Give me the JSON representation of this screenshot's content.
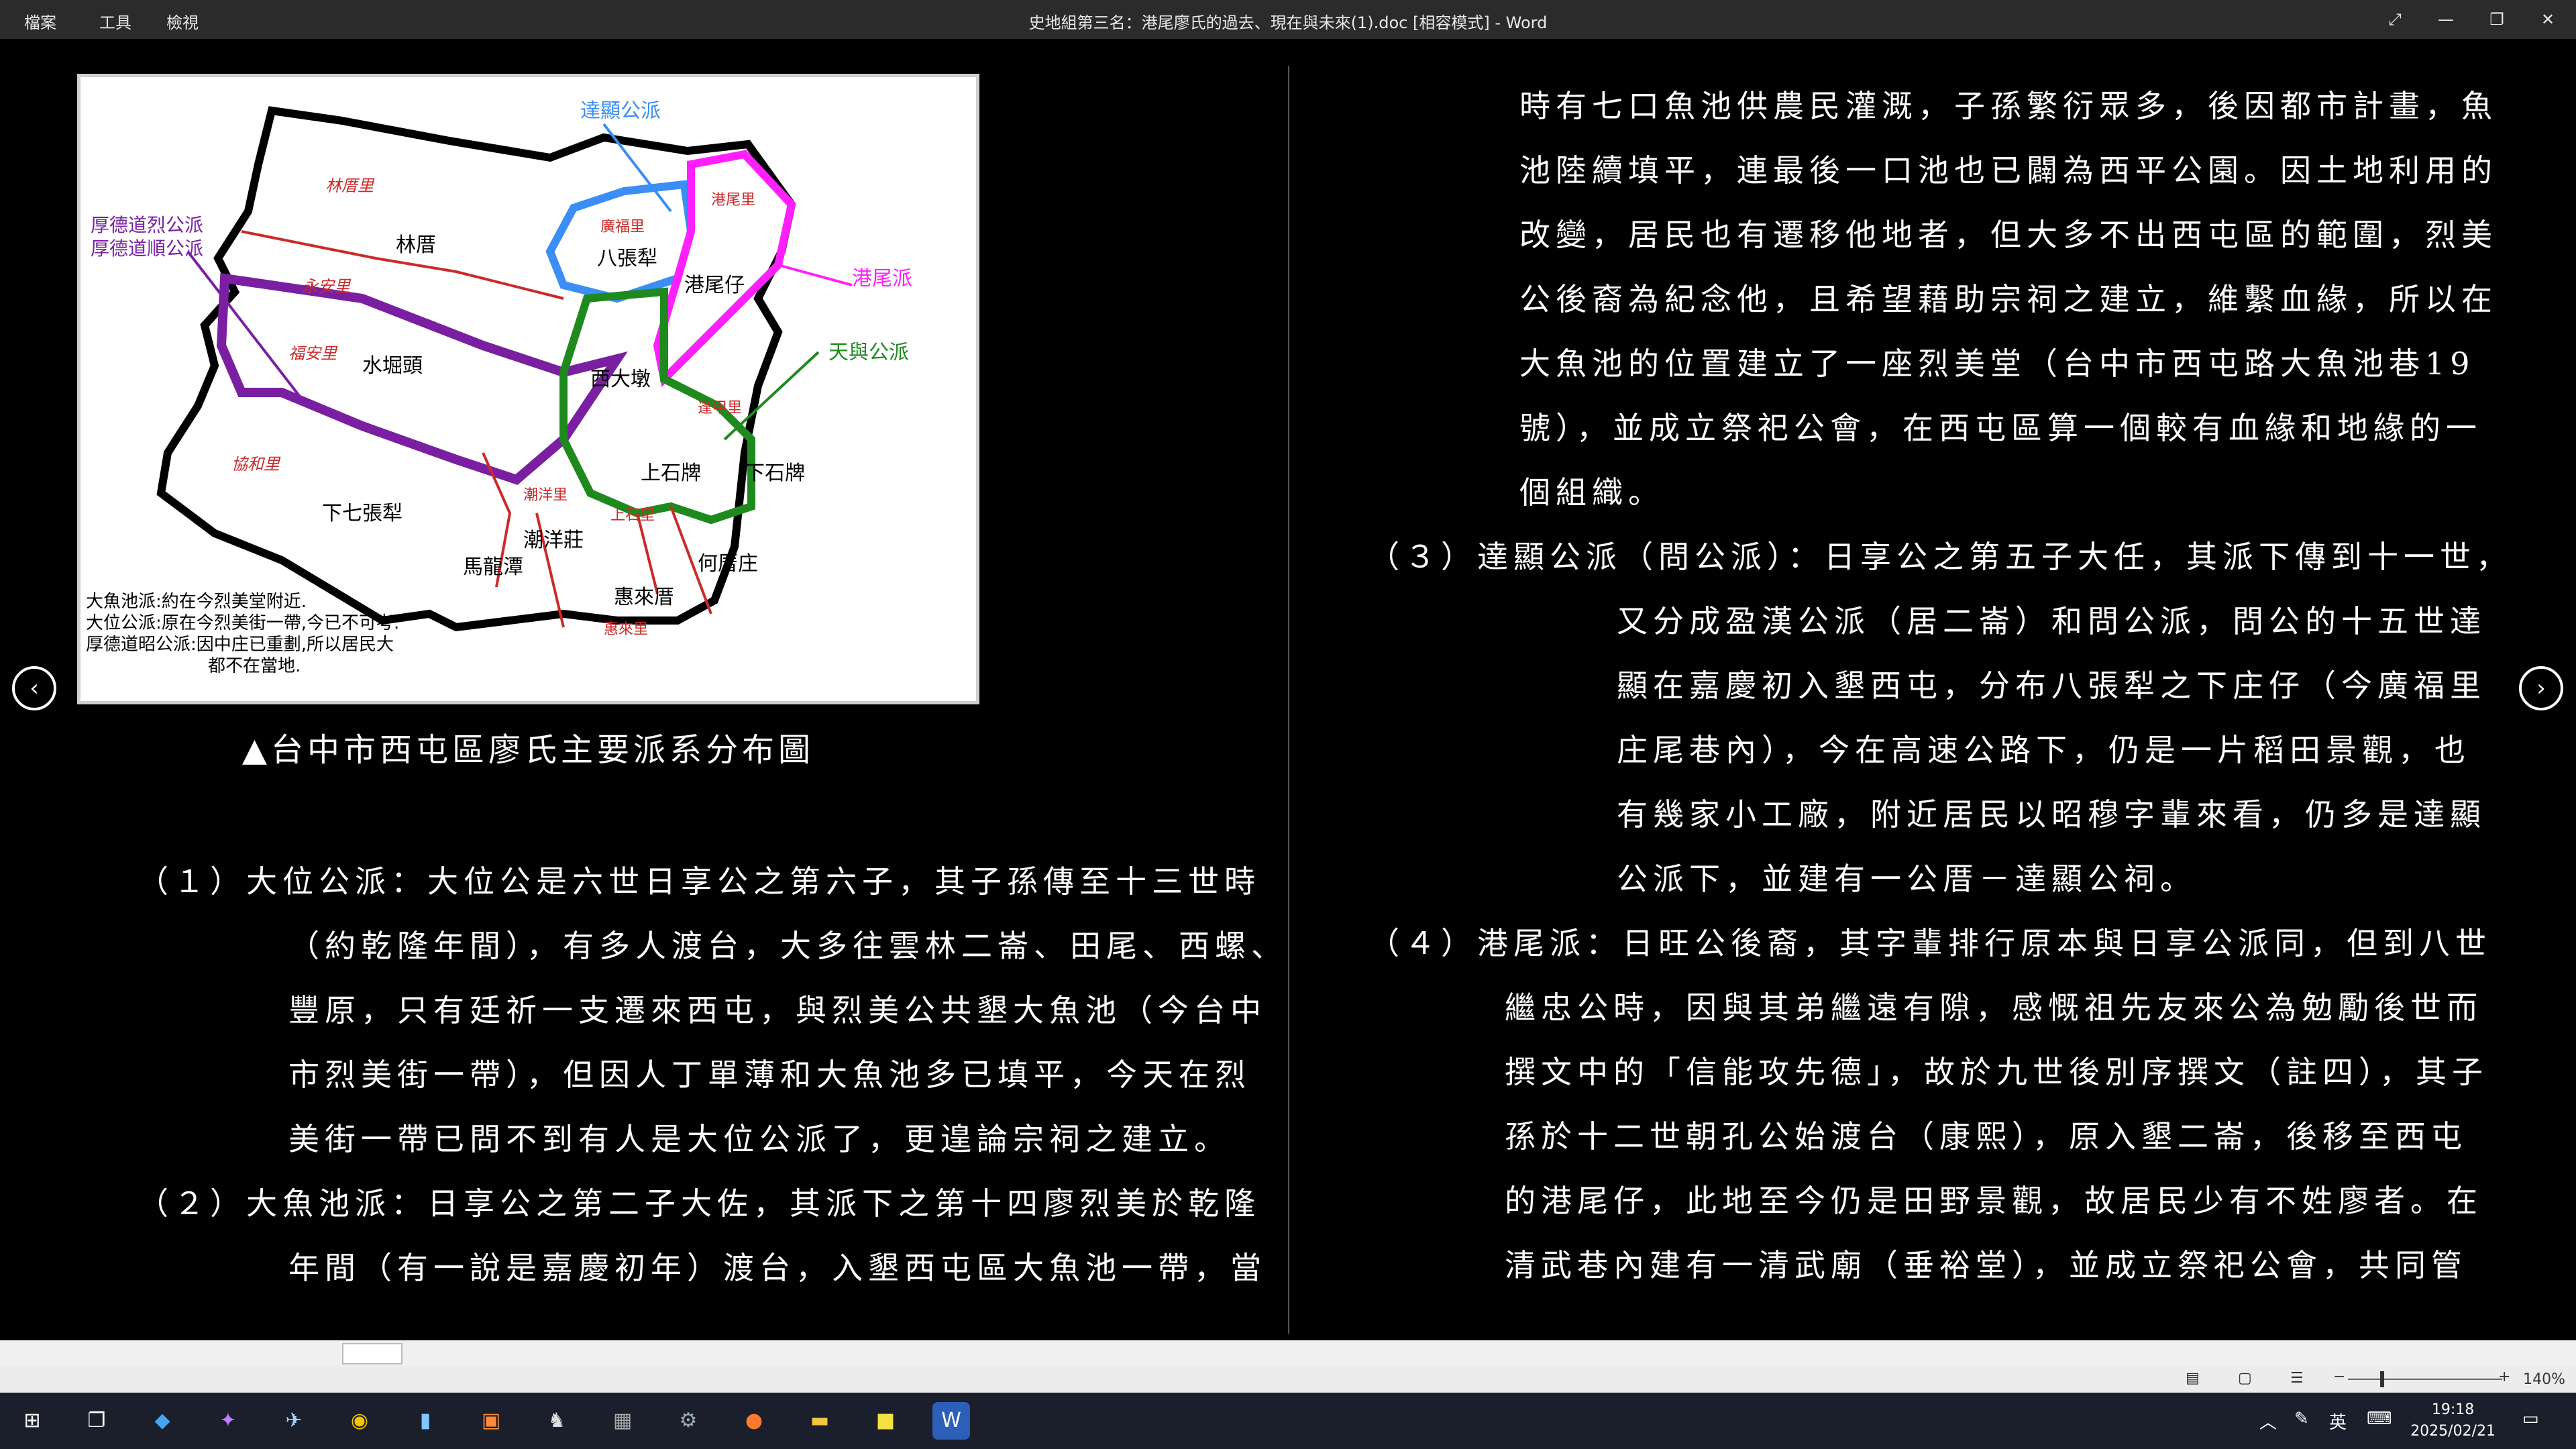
{
  "titlebar": {
    "menu": [
      "檔案",
      "工具",
      "檢視"
    ],
    "document_title": "史地組第三名：港尾廖氏的過去、現在與未來(1).doc [相容模式]  -  Word",
    "buttons": [
      "⤢",
      "—",
      "❐",
      "✕"
    ]
  },
  "map": {
    "labels": {
      "dagong": "達顯公派",
      "liehdao": "厚德道烈公派",
      "shundao": "厚德道順公派",
      "gangwei": "港尾派",
      "tianyu": "天與公派",
      "linli": "林厝里",
      "lin": "林厝",
      "bazhang": "八張犁",
      "gangweizai": "港尾仔",
      "gangweili": "港尾里",
      "yongan": "永安里",
      "fuan": "福安里",
      "shuijue": "水堀頭",
      "xidadun": "西大墩",
      "shangshipai": "上石牌",
      "xiashipai": "下石牌",
      "xiehe": "協和里",
      "xiaqi": "下七張犁",
      "chaoyang": "潮洋里",
      "chaoyangzhuang": "潮洋莊",
      "malongtan": "馬龍潭",
      "huilai": "惠來厝",
      "huilaili": "惠來里",
      "hecuo": "何厝庄",
      "guangfu": "廣福里",
      "shangshi": "上石里",
      "fengan": "逢甲里",
      "notes": [
        "大魚池派:約在今烈美堂附近.",
        "大位公派:原在今烈美街一帶,今已不可考.",
        "厚德道昭公派:因中庄已重劃,所以居民大",
        "都不在當地."
      ]
    }
  },
  "caption": "▲台中市西屯區廖氏主要派系分布圖",
  "left_paragraphs": [
    "（１）大位公派：大位公是六世日享公之第六子，其子孫傳至十三世時",
    "（約乾隆年間），有多人渡台，大多往雲林二崙、田尾、西螺、",
    "豐原，只有廷祈一支遷來西屯，與烈美公共墾大魚池（今台中",
    "市烈美街一帶），但因人丁單薄和大魚池多已填平，今天在烈",
    "美街一帶已問不到有人是大位公派了，更遑論宗祠之建立。",
    "（２）大魚池派：日享公之第二子大佐，其派下之第十四廖烈美於乾隆",
    "年間（有一說是嘉慶初年）渡台，入墾西屯區大魚池一帶，當"
  ],
  "right_paragraphs": [
    "時有七口魚池供農民灌溉，子孫繁衍眾多，後因都市計畫，魚",
    "池陸續填平，連最後一口池也已闢為西平公園。因土地利用的",
    "改變，居民也有遷移他地者，但大多不出西屯區的範圍，烈美",
    "公後裔為紀念他，且希望藉助宗祠之建立，維繫血緣，所以在",
    "大魚池的位置建立了一座烈美堂（台中市西屯路大魚池巷19",
    "號），並成立祭祀公會，在西屯區算一個較有血緣和地緣的一",
    "個組織。",
    "（３）達顯公派（問公派）：日享公之第五子大任，其派下傳到十一世，",
    "又分成盈漢公派（居二崙）和問公派，問公的十五世達",
    "顯在嘉慶初入墾西屯，分布八張犁之下庄仔（今廣福里",
    "庄尾巷內），今在高速公路下，仍是一片稻田景觀，也",
    "有幾家小工廠，附近居民以昭穆字輩來看，仍多是達顯",
    "公派下，並建有一公厝－達顯公祠。",
    "（４）港尾派：日旺公後裔，其字輩排行原本與日享公派同，但到八世",
    "繼忠公時，因與其弟繼遠有隙，感慨祖先友來公為勉勵後世而",
    "撰文中的「信能攻先德」，故於九世後別序撰文（註四），其子",
    "孫於十二世朝孔公始渡台（康熙），原入墾二崙，後移至西屯",
    "的港尾仔，此地至今仍是田野景觀，故居民少有不姓廖者。在",
    "清武巷內建有一清武廟（垂裕堂），並成立祭祀公會，共同管"
  ],
  "statusbar": {
    "zoom": "140%"
  },
  "taskbar": {
    "time": "19:18",
    "date": "2025/02/21",
    "ime": "英"
  }
}
